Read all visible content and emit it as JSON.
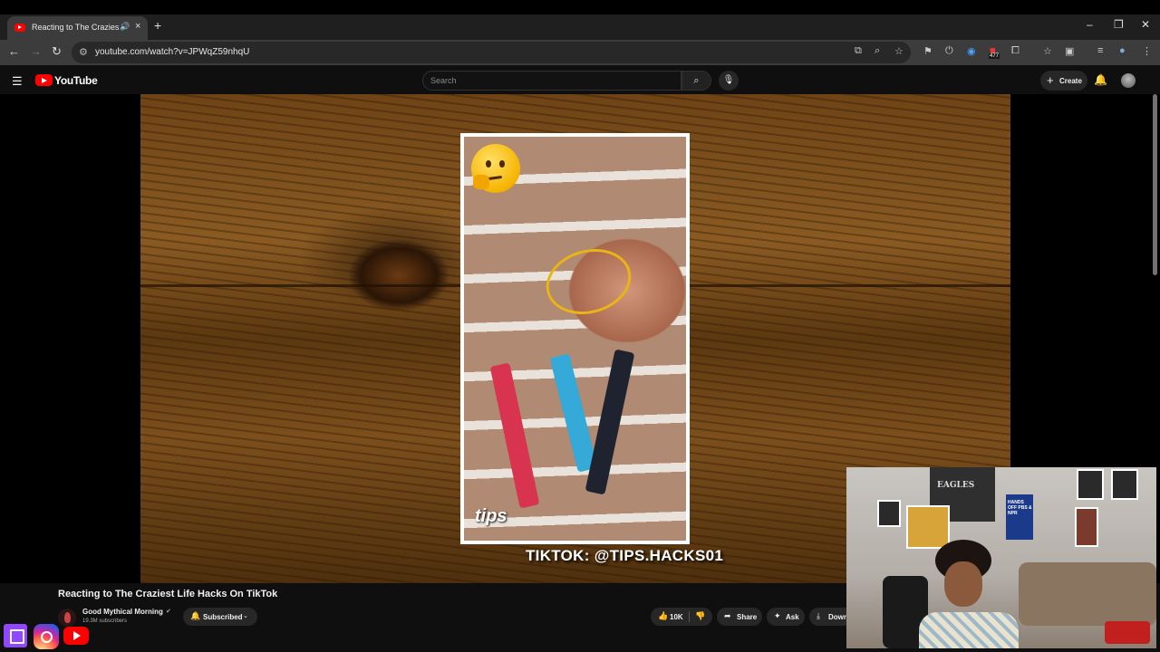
{
  "browser": {
    "tab_title": "Reacting to The Craziest Life Hacks On TikTok",
    "new_tab_symbol": "+",
    "url": "youtube.com/watch?v=JPWqZ59nhqU",
    "extension_badge": "477",
    "window_controls": [
      "–",
      "❐",
      "✕"
    ]
  },
  "youtube": {
    "logo_text": "YouTube",
    "search_placeholder": "Search",
    "create_label": "Create"
  },
  "video": {
    "overlay_text": "TIKTOK: @TIPS.HACKS01",
    "phone_caption": "tips",
    "title": "Reacting to The Craziest Life Hacks On TikTok"
  },
  "channel": {
    "name": "Good Mythical Morning",
    "subscribers": "19.3M subscribers",
    "subscribe_label": "Subscribed"
  },
  "actions": {
    "likes": "10K",
    "share": "Share",
    "ask": "Ask",
    "download": "Download"
  },
  "webcam": {
    "poster_text": "EAGLES",
    "poster2_text": "HANDS OFF PBS & NPR"
  },
  "icons": {
    "back": "arrow-left",
    "forward": "arrow-right",
    "reload": "reload",
    "search": "magnifier",
    "mic": "microphone",
    "bell": "bell",
    "social": [
      "twitch",
      "instagram",
      "youtube"
    ]
  }
}
